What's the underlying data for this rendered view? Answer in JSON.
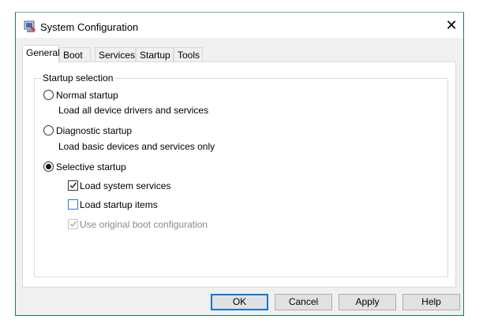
{
  "window": {
    "title": "System Configuration",
    "app_icon": "msconfig-icon",
    "close_glyph": "✕"
  },
  "tabs": [
    {
      "label": "General",
      "active": true
    },
    {
      "label": "Boot",
      "active": false
    },
    {
      "label": "Services",
      "active": false
    },
    {
      "label": "Startup",
      "active": false
    },
    {
      "label": "Tools",
      "active": false
    }
  ],
  "startup_selection": {
    "title": "Startup selection",
    "normal": {
      "label": "Normal startup",
      "description": "Load all device drivers and services",
      "selected": false
    },
    "diagnostic": {
      "label": "Diagnostic startup",
      "description": "Load basic devices and services only",
      "selected": false
    },
    "selective": {
      "label": "Selective startup",
      "selected": true
    },
    "options": [
      {
        "label": "Load system services",
        "checked": true,
        "enabled": true
      },
      {
        "label": "Load startup items",
        "checked": false,
        "enabled": true
      },
      {
        "label": "Use original boot configuration",
        "checked": true,
        "enabled": false
      }
    ]
  },
  "buttons": {
    "ok": "OK",
    "cancel": "Cancel",
    "apply": "Apply",
    "help": "Help"
  },
  "colors": {
    "accent": "#0078d7",
    "window_border": "#1f7a5a",
    "disabled": "#8a8a8a"
  }
}
